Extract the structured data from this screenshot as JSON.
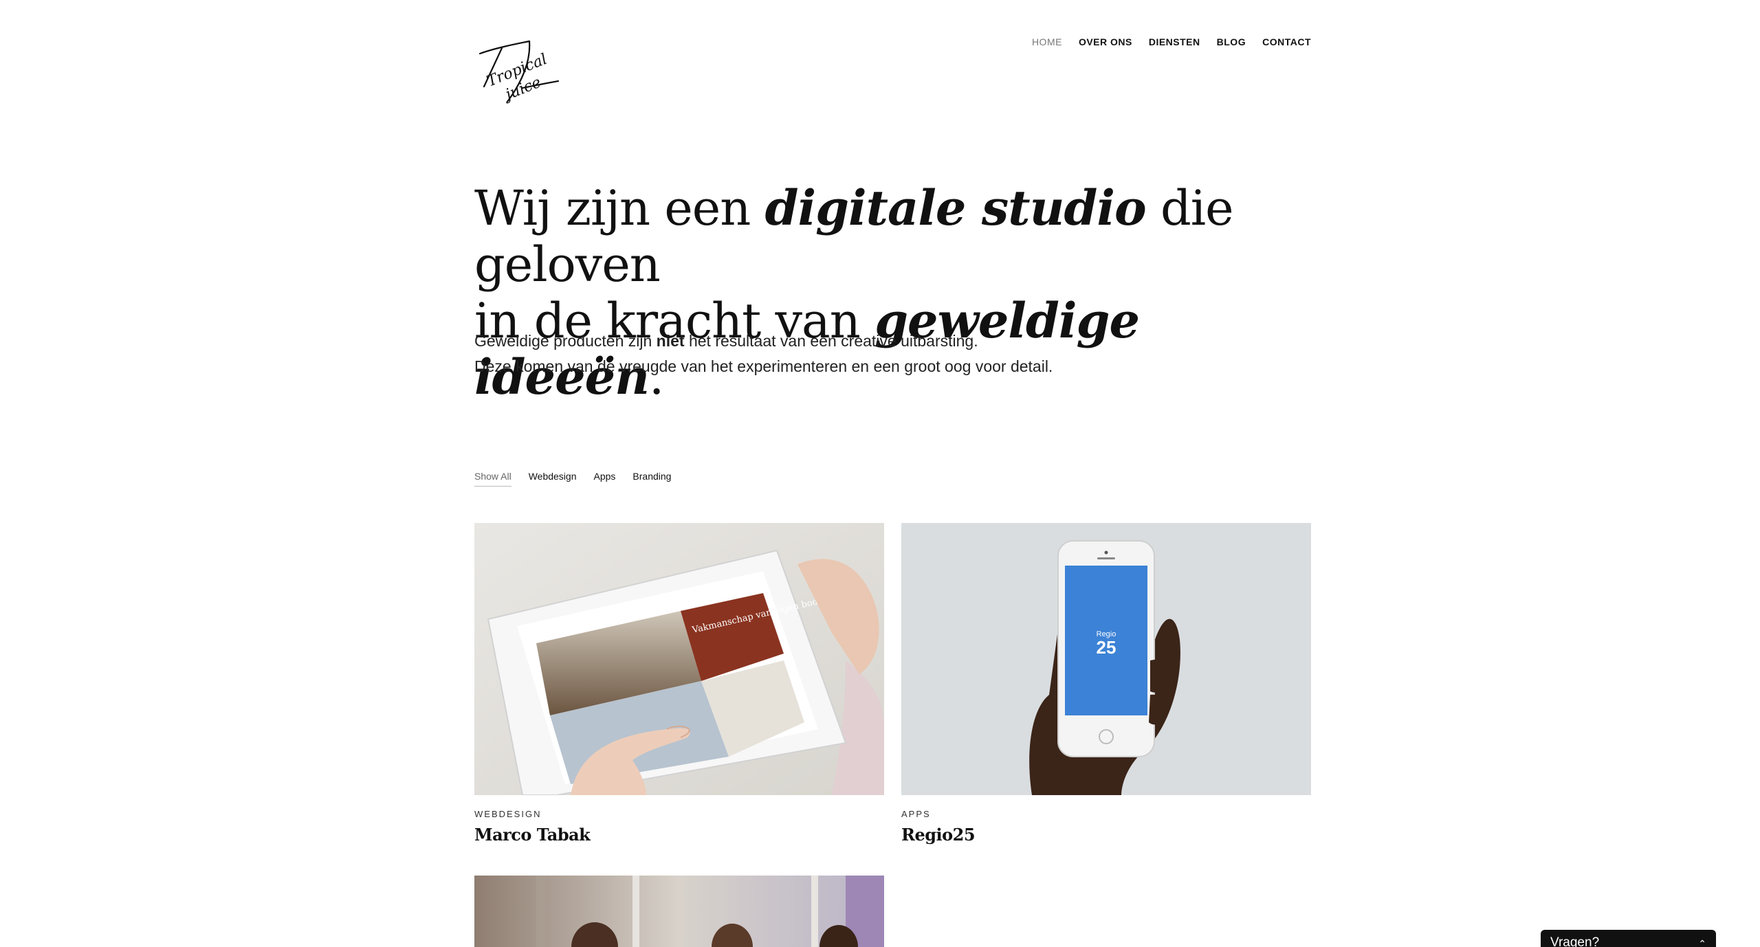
{
  "brand": {
    "logo_text_line1": "Tropical",
    "logo_text_line2": "juice"
  },
  "nav": {
    "items": [
      {
        "label": "HOME",
        "active": true
      },
      {
        "label": "OVER ONS",
        "active": false
      },
      {
        "label": "DIENSTEN",
        "active": false
      },
      {
        "label": "BLOG",
        "active": false
      },
      {
        "label": "CONTACT",
        "active": false
      }
    ]
  },
  "hero": {
    "line1_part1": "Wij zijn een ",
    "line1_em": "digitale studio",
    "line1_part2": " die geloven",
    "line2_part1": "in de kracht van ",
    "line2_em": "geweldige ideeën",
    "line2_part2": "."
  },
  "intro": {
    "line1_part1": "Geweldige producten zijn ",
    "line1_strong": "niet",
    "line1_part2": " het resultaat van een creative uitbarsting.",
    "line2": "Deze komen van de vreugde van het experimenteren en een groot oog voor detail."
  },
  "filters": {
    "items": [
      {
        "label": "Show All",
        "active": true
      },
      {
        "label": "Webdesign",
        "active": false
      },
      {
        "label": "Apps",
        "active": false
      },
      {
        "label": "Branding",
        "active": false
      }
    ]
  },
  "portfolio": [
    {
      "category": "WEBDESIGN",
      "title": "Marco Tabak",
      "screen_text": "Vakmanschap van eigen bodem."
    },
    {
      "category": "APPS",
      "title": "Regio25",
      "phone_label": "Regio",
      "phone_number": "25"
    }
  ],
  "chat": {
    "label": "Vragen?"
  },
  "colors": {
    "text": "#111111",
    "muted": "#777777",
    "card2_bg": "#d9dde0",
    "phone_screen": "#3c82d6",
    "webdesign_panel": "#8a3320"
  }
}
